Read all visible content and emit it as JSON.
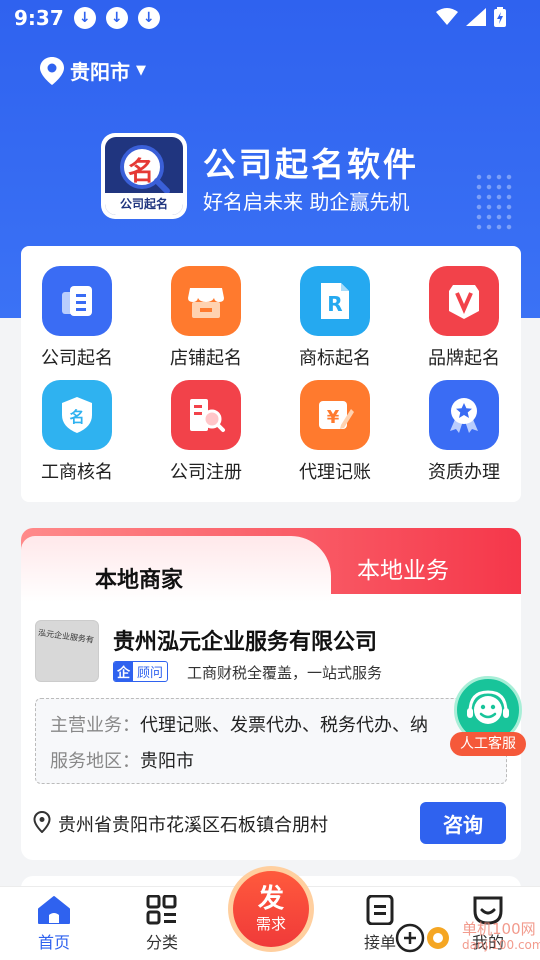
{
  "status_bar": {
    "time": "9:37",
    "download_icons": [
      "↓",
      "↓",
      "↓"
    ]
  },
  "location": {
    "city": "贵阳市"
  },
  "brand": {
    "title": "公司起名软件",
    "subtitle": "好名启未来 助企赢先机",
    "logo_char": "名",
    "logo_caption": "公司起名"
  },
  "services": [
    {
      "label": "公司起名",
      "icon": "document-stack-icon",
      "color": "#3a6cf4",
      "glyph": "▤"
    },
    {
      "label": "店铺起名",
      "icon": "storefront-icon",
      "color": "#ff7a2e",
      "glyph": "▭"
    },
    {
      "label": "商标起名",
      "icon": "trademark-r-icon",
      "color": "#25a9f0",
      "glyph": "R"
    },
    {
      "label": "品牌起名",
      "icon": "brand-v-badge-icon",
      "color": "#f2424a",
      "glyph": "V"
    },
    {
      "label": "工商核名",
      "icon": "shield-name-icon",
      "color": "#2fb2f0",
      "glyph": "名"
    },
    {
      "label": "公司注册",
      "icon": "register-search-icon",
      "color": "#f2424a",
      "glyph": "▦"
    },
    {
      "label": "代理记账",
      "icon": "accounting-icon",
      "color": "#ff7a2e",
      "glyph": "¥"
    },
    {
      "label": "资质办理",
      "icon": "award-badge-icon",
      "color": "#3a6cf4",
      "glyph": "★"
    }
  ],
  "merchant_tabs": {
    "active": "本地商家",
    "inactive": "本地业务"
  },
  "merchant": {
    "thumb_text": "泓元企业服务有",
    "name": "贵州泓元企业服务有限公司",
    "badge_a": "企",
    "badge_b": "顾问",
    "slogan": "工商财税全覆盖，一站式服务",
    "main_business_label": "主营业务：",
    "main_business_value": "代理记账、发票代办、税务代办、纳",
    "service_area_label": "服务地区：",
    "service_area_value": "贵阳市",
    "address": "贵州省贵阳市花溪区石板镇合朋村",
    "consult_label": "咨询"
  },
  "customer_service": {
    "label": "人工客服"
  },
  "bottom_nav": {
    "home": "首页",
    "category": "分类",
    "publish_big": "发",
    "publish_small": "需求",
    "orders": "接单",
    "mine": "我的"
  },
  "watermark": {
    "line1": "单机100网",
    "line2": "danji100.com"
  },
  "colors": {
    "primary": "#2f62ef",
    "accent_red": "#f5374a",
    "cs_green": "#18c49a"
  }
}
